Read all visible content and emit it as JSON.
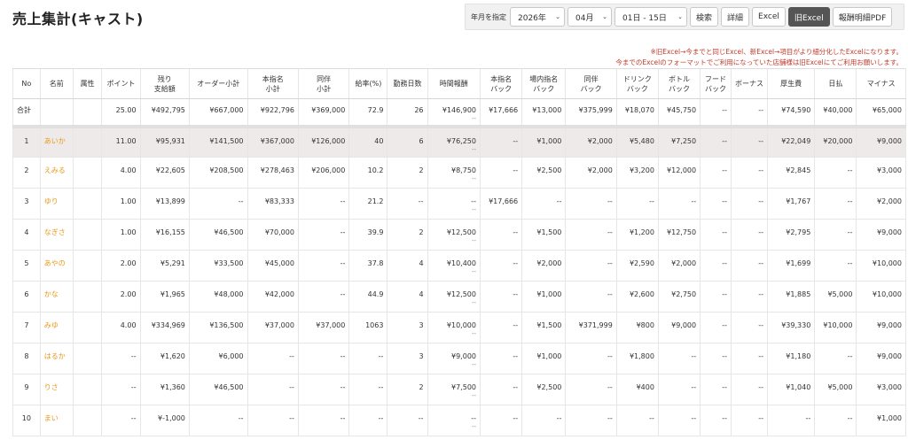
{
  "page": {
    "title": "売上集計(キャスト)"
  },
  "toolbar": {
    "month_label": "年月を指定",
    "year_value": "2026年",
    "month_value": "04月",
    "period_value": "01日 - 15日",
    "search_label": "検索",
    "detail_label": "詳細",
    "excel_label": "Excel",
    "old_excel_label": "旧Excel",
    "pdf_label": "報酬明細PDF"
  },
  "notes": {
    "line1": "※旧Excel→今までと同じExcel、新Excel→項目がより細分化したExcelになります。",
    "line2": "今までのExcelのフォーマットでご利用になっていた店舗様は旧Excelにてご利用お願いします。"
  },
  "table": {
    "headers": [
      [
        "No"
      ],
      [
        "名前"
      ],
      [
        "属性"
      ],
      [
        "ポイント"
      ],
      [
        "残り",
        "支給額"
      ],
      [
        "オーダー小計"
      ],
      [
        "本指名",
        "小計"
      ],
      [
        "同伴",
        "小計"
      ],
      [
        "給率(%)"
      ],
      [
        "勤務日数"
      ],
      [
        "時間報酬"
      ],
      [
        "本指名",
        "バック"
      ],
      [
        "場内指名",
        "バック"
      ],
      [
        "同伴",
        "バック"
      ],
      [
        "ドリンク",
        "バック"
      ],
      [
        "ボトル",
        "バック"
      ],
      [
        "フード",
        "バック"
      ],
      [
        "ボーナス"
      ],
      [
        "厚生費"
      ],
      [
        "日払"
      ],
      [
        "マイナス"
      ]
    ],
    "total": {
      "label": "合計",
      "cells": [
        "",
        "",
        "25.00",
        "¥492,795",
        "¥667,000",
        "¥922,796",
        "¥369,000",
        "72.9",
        "26",
        "¥146,900",
        "¥17,666",
        "¥13,000",
        "¥375,999",
        "¥18,070",
        "¥45,750",
        "--",
        "--",
        "¥74,590",
        "¥40,000",
        "¥65,000"
      ],
      "time_sub": "--"
    },
    "rows": [
      {
        "no": "1",
        "name": "あいか",
        "attr": "",
        "cells": [
          "11.00",
          "¥95,931",
          "¥141,500",
          "¥367,000",
          "¥126,000",
          "40",
          "6",
          "¥76,250",
          "--",
          "¥1,000",
          "¥2,000",
          "¥5,480",
          "¥7,250",
          "--",
          "--",
          "¥22,049",
          "¥20,000",
          "¥9,000"
        ],
        "time_sub": "--"
      },
      {
        "no": "2",
        "name": "えみる",
        "attr": "",
        "cells": [
          "4.00",
          "¥22,605",
          "¥208,500",
          "¥278,463",
          "¥206,000",
          "10.2",
          "2",
          "¥8,750",
          "--",
          "¥2,500",
          "¥2,000",
          "¥3,200",
          "¥12,000",
          "--",
          "--",
          "¥2,845",
          "--",
          "¥3,000"
        ],
        "time_sub": "--"
      },
      {
        "no": "3",
        "name": "ゆり",
        "attr": "",
        "cells": [
          "1.00",
          "¥13,899",
          "--",
          "¥83,333",
          "--",
          "21.2",
          "--",
          "--",
          "¥17,666",
          "--",
          "--",
          "--",
          "--",
          "--",
          "--",
          "¥1,767",
          "--",
          "¥2,000"
        ],
        "time_sub": "--"
      },
      {
        "no": "4",
        "name": "なぎさ",
        "attr": "",
        "cells": [
          "1.00",
          "¥16,155",
          "¥46,500",
          "¥70,000",
          "--",
          "39.9",
          "2",
          "¥12,500",
          "--",
          "¥1,500",
          "--",
          "¥1,200",
          "¥12,750",
          "--",
          "--",
          "¥2,795",
          "--",
          "¥9,000"
        ],
        "time_sub": "--"
      },
      {
        "no": "5",
        "name": "あやの",
        "attr": "",
        "cells": [
          "2.00",
          "¥5,291",
          "¥33,500",
          "¥45,000",
          "--",
          "37.8",
          "4",
          "¥10,400",
          "--",
          "¥2,000",
          "--",
          "¥2,590",
          "¥2,000",
          "--",
          "--",
          "¥1,699",
          "--",
          "¥10,000"
        ],
        "time_sub": "--"
      },
      {
        "no": "6",
        "name": "かな",
        "attr": "",
        "cells": [
          "2.00",
          "¥1,965",
          "¥48,000",
          "¥42,000",
          "--",
          "44.9",
          "4",
          "¥12,500",
          "--",
          "¥1,000",
          "--",
          "¥2,600",
          "¥2,750",
          "--",
          "--",
          "¥1,885",
          "¥5,000",
          "¥10,000"
        ],
        "time_sub": "--"
      },
      {
        "no": "7",
        "name": "みゆ",
        "attr": "",
        "cells": [
          "4.00",
          "¥334,969",
          "¥136,500",
          "¥37,000",
          "¥37,000",
          "1063",
          "3",
          "¥10,000",
          "--",
          "¥1,500",
          "¥371,999",
          "¥800",
          "¥9,000",
          "--",
          "--",
          "¥39,330",
          "¥10,000",
          "¥9,000"
        ],
        "time_sub": "--"
      },
      {
        "no": "8",
        "name": "はるか",
        "attr": "",
        "cells": [
          "--",
          "¥1,620",
          "¥6,000",
          "--",
          "--",
          "--",
          "3",
          "¥9,000",
          "--",
          "¥1,000",
          "--",
          "¥1,800",
          "--",
          "--",
          "--",
          "¥1,180",
          "--",
          "¥9,000"
        ],
        "time_sub": "--"
      },
      {
        "no": "9",
        "name": "りさ",
        "attr": "",
        "cells": [
          "--",
          "¥1,360",
          "¥46,500",
          "--",
          "--",
          "--",
          "2",
          "¥7,500",
          "--",
          "¥2,500",
          "--",
          "¥400",
          "--",
          "--",
          "--",
          "¥1,040",
          "¥5,000",
          "¥3,000"
        ],
        "time_sub": "--"
      },
      {
        "no": "10",
        "name": "まい",
        "attr": "",
        "cells": [
          "--",
          "¥-1,000",
          "--",
          "--",
          "--",
          "--",
          "--",
          "--",
          "--",
          "--",
          "--",
          "--",
          "--",
          "--",
          "--",
          "--",
          "--",
          "¥1,000"
        ],
        "time_sub": "--"
      }
    ]
  }
}
